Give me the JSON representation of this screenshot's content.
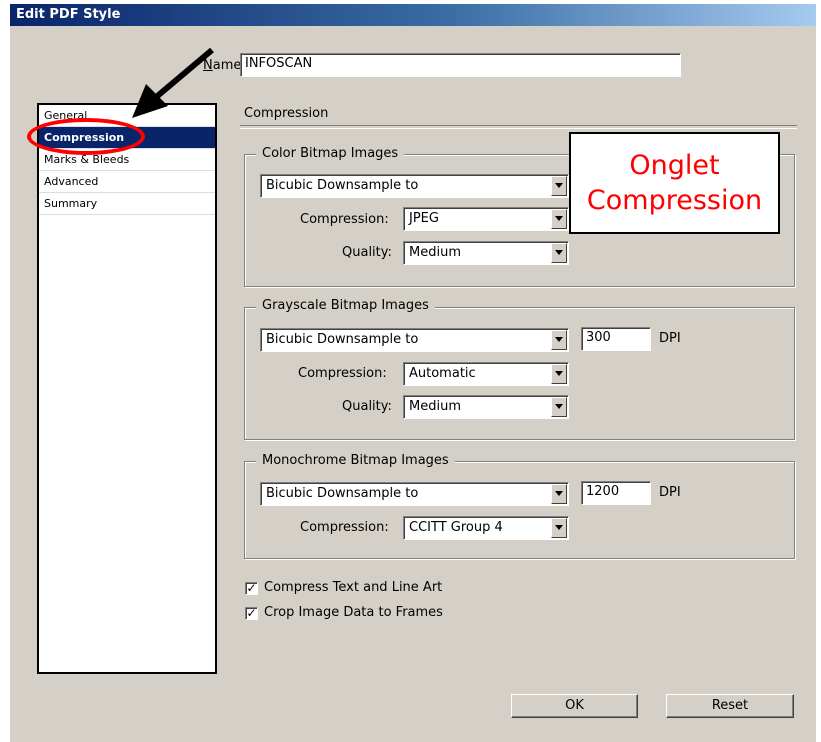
{
  "window": {
    "title": "Edit PDF Style"
  },
  "name_field": {
    "label_key": "N",
    "label_rest": "ame:",
    "value": "INFOSCAN"
  },
  "sidebar": {
    "items": [
      {
        "label": "General"
      },
      {
        "label": "Compression",
        "selected": true
      },
      {
        "label": "Marks & Bleeds"
      },
      {
        "label": "Advanced"
      },
      {
        "label": "Summary"
      }
    ]
  },
  "section_title": "Compression",
  "color_images": {
    "legend": "Color Bitmap Images",
    "downsample": "Bicubic Downsample to",
    "compression_label": "Compression:",
    "compression": "JPEG",
    "quality_label": "Quality:",
    "quality": "Medium"
  },
  "grayscale_images": {
    "legend": "Grayscale Bitmap Images",
    "downsample": "Bicubic Downsample to",
    "dpi_value": "300",
    "dpi_label": "DPI",
    "compression_label": "Compression:",
    "compression": "Automatic",
    "quality_label": "Quality:",
    "quality": "Medium"
  },
  "mono_images": {
    "legend": "Monochrome Bitmap Images",
    "downsample": "Bicubic Downsample to",
    "dpi_value": "1200",
    "dpi_label": "DPI",
    "compression_label": "Compression:",
    "compression": "CCITT Group 4"
  },
  "options": {
    "compress_text": {
      "label": "Compress Text and Line Art",
      "checked": true
    },
    "crop_image": {
      "label": "Crop Image Data to Frames",
      "checked": true
    }
  },
  "buttons": {
    "ok": "OK",
    "reset": "Reset"
  },
  "annotation": {
    "line1": "Onglet",
    "line2": "Compression",
    "color": "#ff0000"
  },
  "colors": {
    "titlebar": "#0a246a",
    "selection": "#0a246a",
    "face": "#d4d0c8"
  }
}
